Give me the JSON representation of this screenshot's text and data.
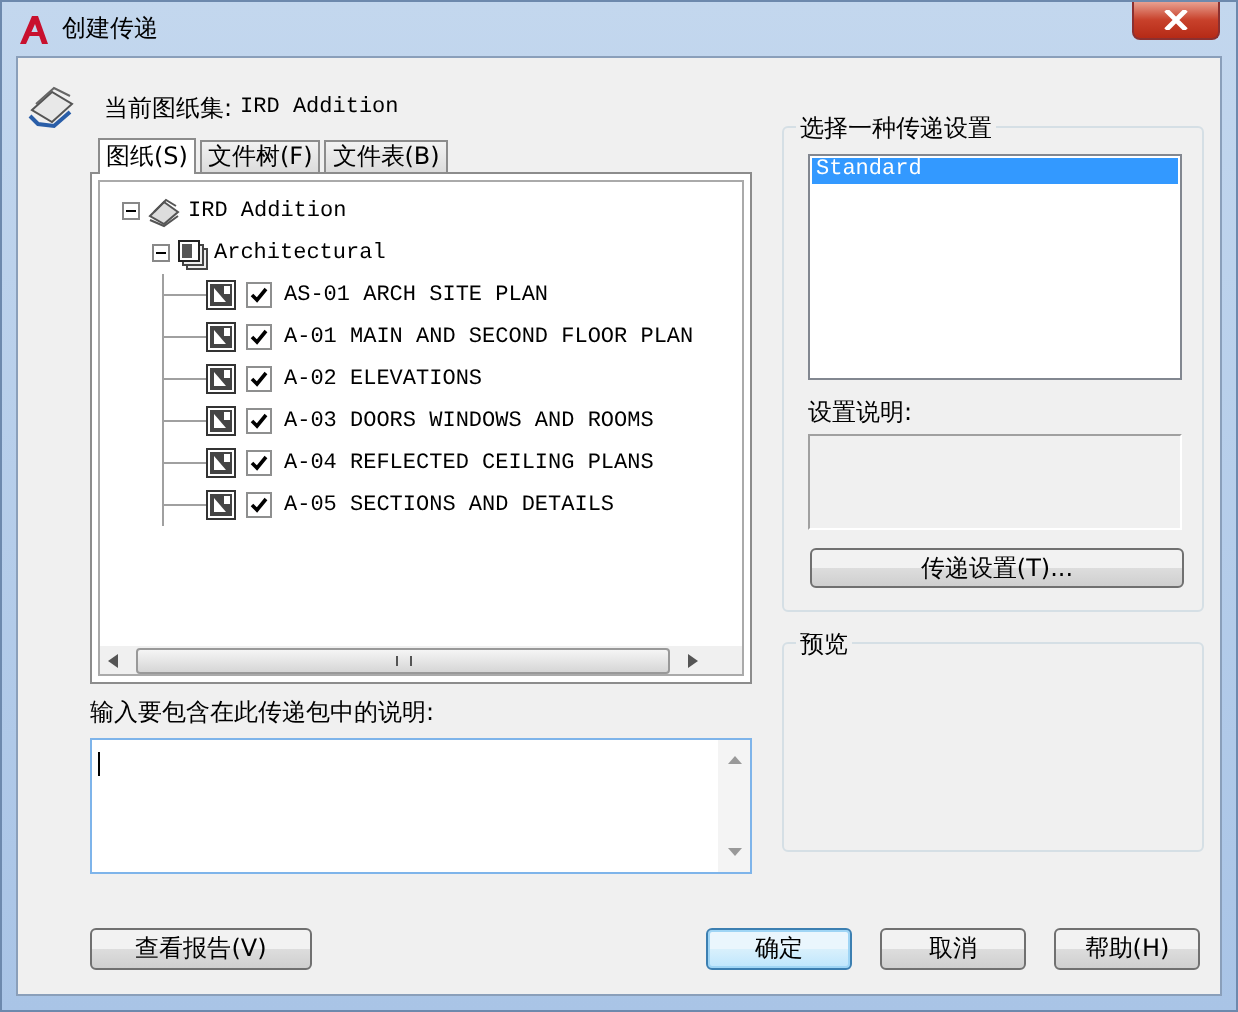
{
  "window": {
    "title": "创建传递"
  },
  "sheet_set": {
    "label": "当前图纸集:",
    "name": "IRD Addition"
  },
  "tabs": [
    {
      "label": "图纸(S)",
      "selected": true
    },
    {
      "label": "文件树(F)",
      "selected": false
    },
    {
      "label": "文件表(B)",
      "selected": false
    }
  ],
  "tree": {
    "label": "IRD Addition",
    "kind": "set",
    "expanded": true,
    "children": [
      {
        "label": "Architectural",
        "kind": "subset",
        "expanded": true,
        "children": [
          {
            "label": "AS-01 ARCH SITE PLAN",
            "kind": "sheet",
            "checked": true
          },
          {
            "label": "A-01 MAIN AND SECOND FLOOR PLAN",
            "kind": "sheet",
            "checked": true
          },
          {
            "label": "A-02 ELEVATIONS",
            "kind": "sheet",
            "checked": true
          },
          {
            "label": "A-03 DOORS WINDOWS AND ROOMS",
            "kind": "sheet",
            "checked": true
          },
          {
            "label": "A-04 REFLECTED CEILING PLANS",
            "kind": "sheet",
            "checked": true
          },
          {
            "label": "A-05 SECTIONS AND DETAILS",
            "kind": "sheet",
            "checked": true
          }
        ]
      }
    ]
  },
  "notes": {
    "label": "输入要包含在此传递包中的说明:"
  },
  "setup": {
    "title": "选择一种传递设置",
    "items": [
      {
        "label": "Standard",
        "selected": true
      }
    ],
    "description_label": "设置说明:",
    "button": "传递设置(T)..."
  },
  "preview": {
    "title": "预览"
  },
  "buttons": [
    {
      "label": "查看报告(V)",
      "default": false
    },
    {
      "label": "确定",
      "default": true
    },
    {
      "label": "取消",
      "default": false
    },
    {
      "label": "帮助(H)",
      "default": false
    }
  ]
}
